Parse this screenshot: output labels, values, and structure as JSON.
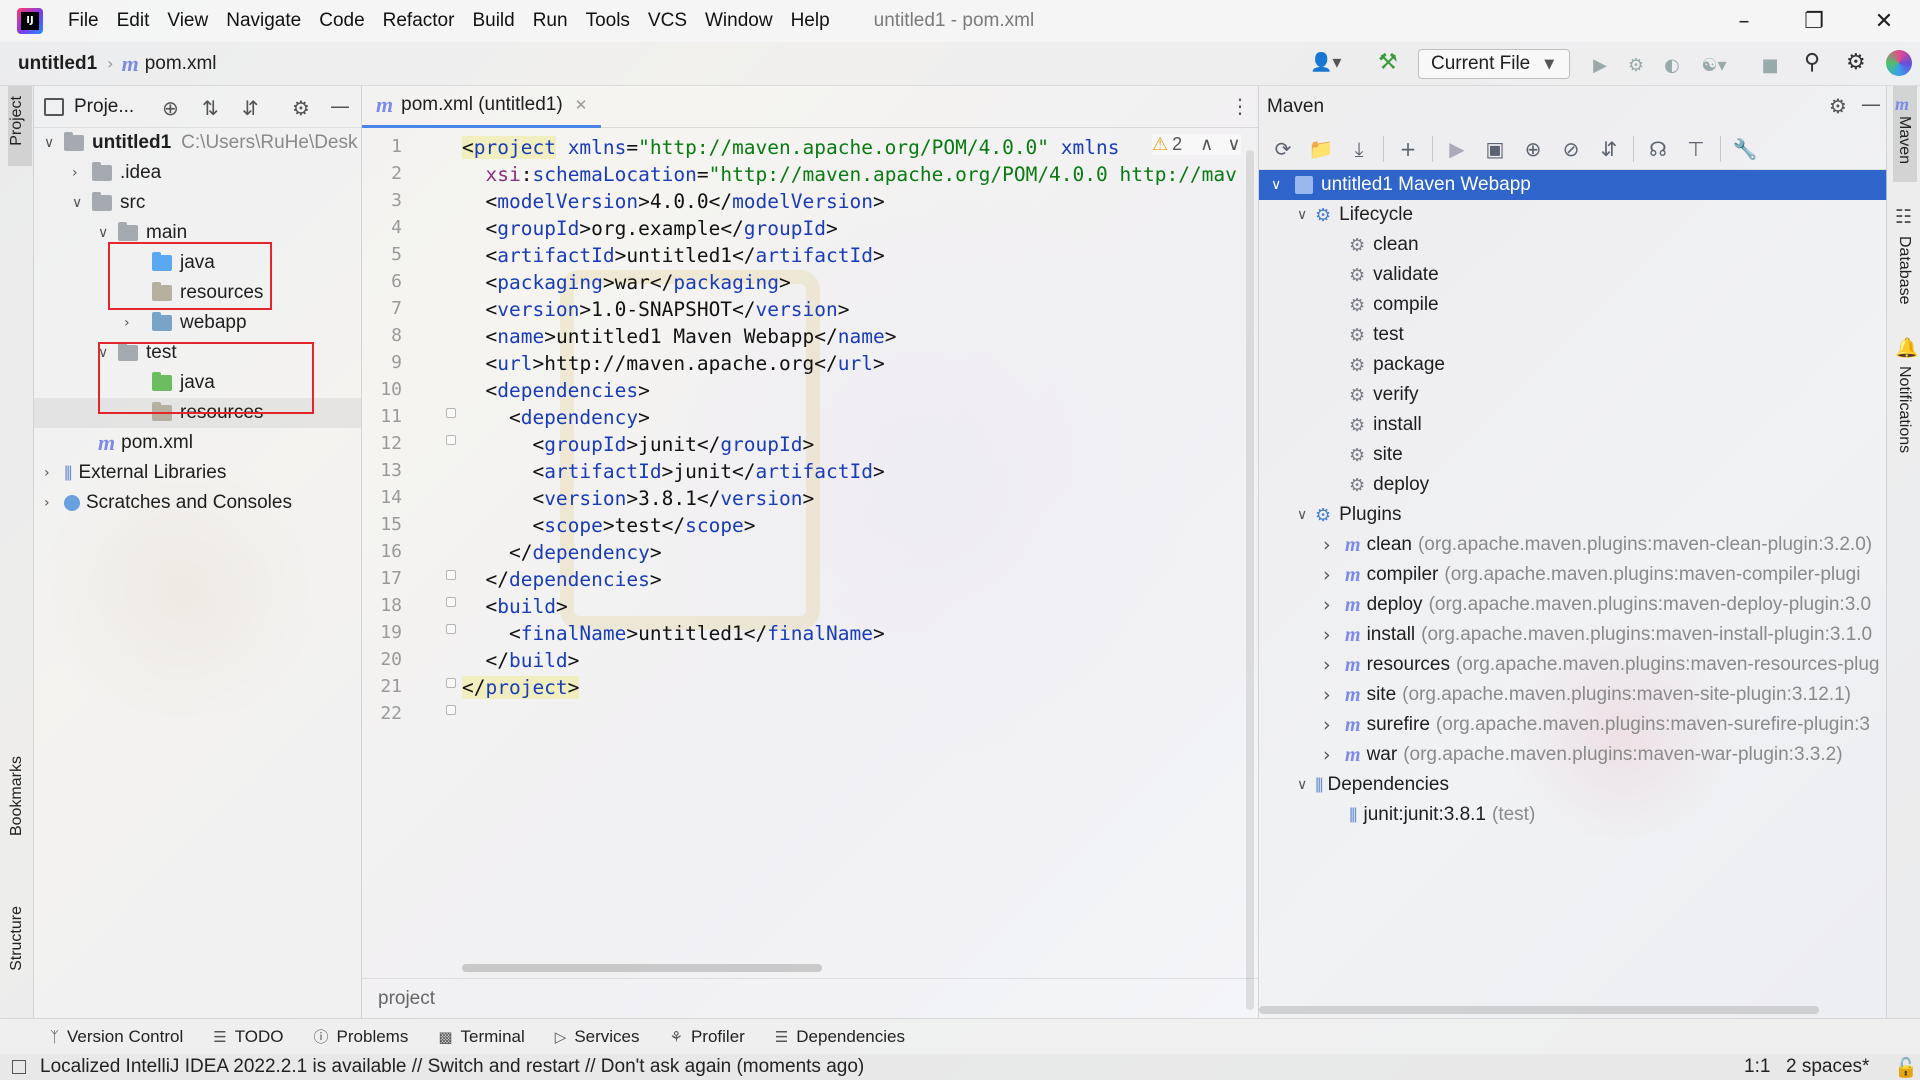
{
  "menubar": {
    "items": [
      "File",
      "Edit",
      "View",
      "Navigate",
      "Code",
      "Refactor",
      "Build",
      "Run",
      "Tools",
      "VCS",
      "Window",
      "Help"
    ],
    "window_title": "untitled1 - pom.xml"
  },
  "navbar": {
    "project": "untitled1",
    "file": "pom.xml",
    "run_config": "Current File"
  },
  "left_strip": {
    "project": "Project",
    "bookmarks": "Bookmarks",
    "structure": "Structure"
  },
  "project_panel": {
    "title": "Proje...",
    "tree": [
      {
        "label": "untitled1",
        "path": "C:\\Users\\RuHe\\Desk"
      },
      {
        "label": ".idea"
      },
      {
        "label": "src"
      },
      {
        "label": "main"
      },
      {
        "label": "java"
      },
      {
        "label": "resources"
      },
      {
        "label": "webapp"
      },
      {
        "label": "test"
      },
      {
        "label": "java"
      },
      {
        "label": "resources"
      },
      {
        "label": "pom.xml"
      },
      {
        "label": "External Libraries"
      },
      {
        "label": "Scratches and Consoles"
      }
    ]
  },
  "editor": {
    "tab_label": "pom.xml (untitled1)",
    "warning_count": "2",
    "breadcrumb": "project",
    "line_numbers": [
      "1",
      "2",
      "3",
      "4",
      "5",
      "6",
      "7",
      "8",
      "9",
      "10",
      "11",
      "12",
      "13",
      "14",
      "15",
      "16",
      "17",
      "18",
      "19",
      "20",
      "21",
      "22"
    ],
    "code": {
      "l1_tag": "project",
      "l1_attr1": "xmlns",
      "l1_val1": "\"http://maven.apache.org/POM/4.0.0\"",
      "l1_attr2": "xmlns",
      "l2_ns": "xsi",
      "l2_attr": "schemaLocation",
      "l2_val": "\"http://maven.apache.org/POM/4.0.0 http://mav",
      "model_version": "4.0.0",
      "group_id": "org.example",
      "artifact_id": "untitled1",
      "packaging": "war",
      "version": "1.0-SNAPSHOT",
      "name": "untitled1 Maven Webapp",
      "url": "http://maven.apache.org",
      "dep_group_id": "junit",
      "dep_artifact_id": "junit",
      "dep_version": "3.8.1",
      "dep_scope": "test",
      "final_name": "untitled1"
    }
  },
  "maven": {
    "title": "Maven",
    "root": "untitled1 Maven Webapp",
    "lifecycle_label": "Lifecycle",
    "lifecycle": [
      "clean",
      "validate",
      "compile",
      "test",
      "package",
      "verify",
      "install",
      "site",
      "deploy"
    ],
    "plugins_label": "Plugins",
    "plugins": [
      {
        "name": "clean",
        "detail": "(org.apache.maven.plugins:maven-clean-plugin:3.2.0)"
      },
      {
        "name": "compiler",
        "detail": "(org.apache.maven.plugins:maven-compiler-plugi"
      },
      {
        "name": "deploy",
        "detail": "(org.apache.maven.plugins:maven-deploy-plugin:3.0"
      },
      {
        "name": "install",
        "detail": "(org.apache.maven.plugins:maven-install-plugin:3.1.0"
      },
      {
        "name": "resources",
        "detail": "(org.apache.maven.plugins:maven-resources-plug"
      },
      {
        "name": "site",
        "detail": "(org.apache.maven.plugins:maven-site-plugin:3.12.1)"
      },
      {
        "name": "surefire",
        "detail": "(org.apache.maven.plugins:maven-surefire-plugin:3"
      },
      {
        "name": "war",
        "detail": "(org.apache.maven.plugins:maven-war-plugin:3.3.2)"
      }
    ],
    "dependencies_label": "Dependencies",
    "dependency": {
      "name": "junit:junit:3.8.1",
      "scope": "(test)"
    }
  },
  "right_strip": {
    "maven": "Maven",
    "database": "Database",
    "notifications": "Notifications"
  },
  "bottom_tools": [
    "Version Control",
    "TODO",
    "Problems",
    "Terminal",
    "Services",
    "Profiler",
    "Dependencies"
  ],
  "status": {
    "message": "Localized IntelliJ IDEA 2022.2.1 is available // Switch and restart // Don't ask again (moments ago)",
    "position": "1:1",
    "indent": "2 spaces*"
  },
  "colors": {
    "selection": "#2f65ca",
    "highlight_box": "#e3262b",
    "xml_tag": "#1a3cb8",
    "xml_value": "#097a14"
  }
}
